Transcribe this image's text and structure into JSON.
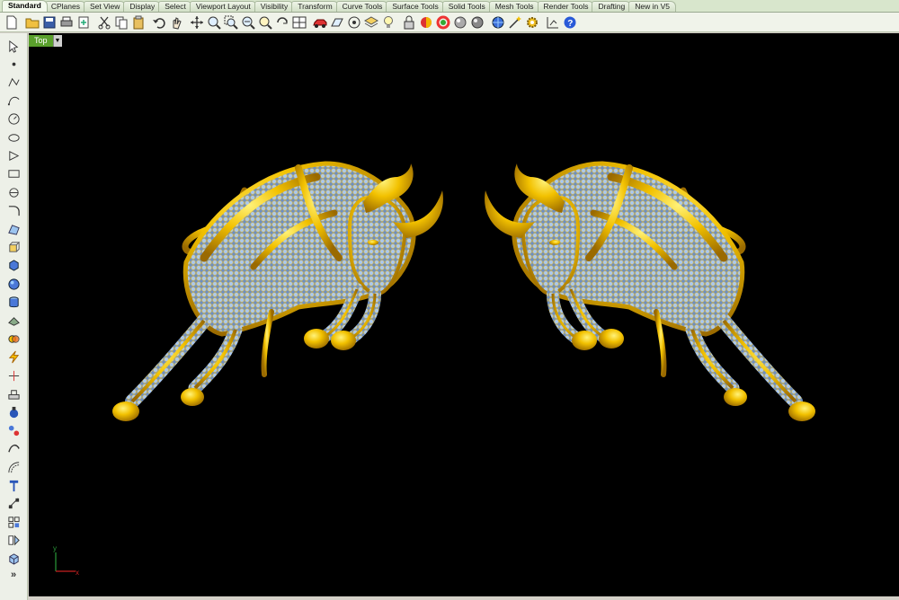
{
  "tabs": [
    "Standard",
    "CPlanes",
    "Set View",
    "Display",
    "Select",
    "Viewport Layout",
    "Visibility",
    "Transform",
    "Curve Tools",
    "Surface Tools",
    "Solid Tools",
    "Mesh Tools",
    "Render Tools",
    "Drafting",
    "New in V5"
  ],
  "active_tab": "Standard",
  "toolbar_icons": [
    "new-file-icon",
    "open-folder-icon",
    "save-icon",
    "print-icon",
    "import-icon",
    "cut-icon",
    "copy-icon",
    "paste-icon",
    "undo-icon",
    "pan-hand-icon",
    "move-icon",
    "zoom-icon",
    "zoom-window-icon",
    "zoom-extents-icon",
    "zoom-selected-icon",
    "rotate-view-icon",
    "four-viewports-icon",
    "car-icon",
    "cplane-icon",
    "circle-target-icon",
    "layers-icon",
    "lightbulb-icon",
    "lock-icon",
    "material-icon",
    "color-wheel-icon",
    "render-sphere-icon",
    "render-preview-icon",
    "globe-icon",
    "wand-icon",
    "gear-icon",
    "grid-snap-icon",
    "help-icon"
  ],
  "left_tools": [
    "select-arrow-icon",
    "point-icon",
    "polyline-icon",
    "curve-icon",
    "circle-icon",
    "ellipse-icon",
    "polygon-icon",
    "rectangle-icon",
    "arc-icon",
    "fillet-icon",
    "surface-icon",
    "extrude-icon",
    "box-solid-icon",
    "sphere-solid-icon",
    "cylinder-icon",
    "plane-icon",
    "boolean-icon",
    "lightning-icon",
    "split-icon",
    "trim-icon",
    "join-icon",
    "group-icon",
    "offset-icon",
    "array-icon",
    "text-icon",
    "dimension-icon",
    "transform-icon",
    "mirror-icon",
    "mesh-icon"
  ],
  "more_label": "»",
  "viewport": {
    "name": "Top",
    "background": "#000000",
    "accent": "#5aa02c"
  },
  "axis": {
    "y_label": "y",
    "x_label": "x"
  },
  "colors": {
    "gold": "#e8b400",
    "gem": "#8fb4e8"
  }
}
